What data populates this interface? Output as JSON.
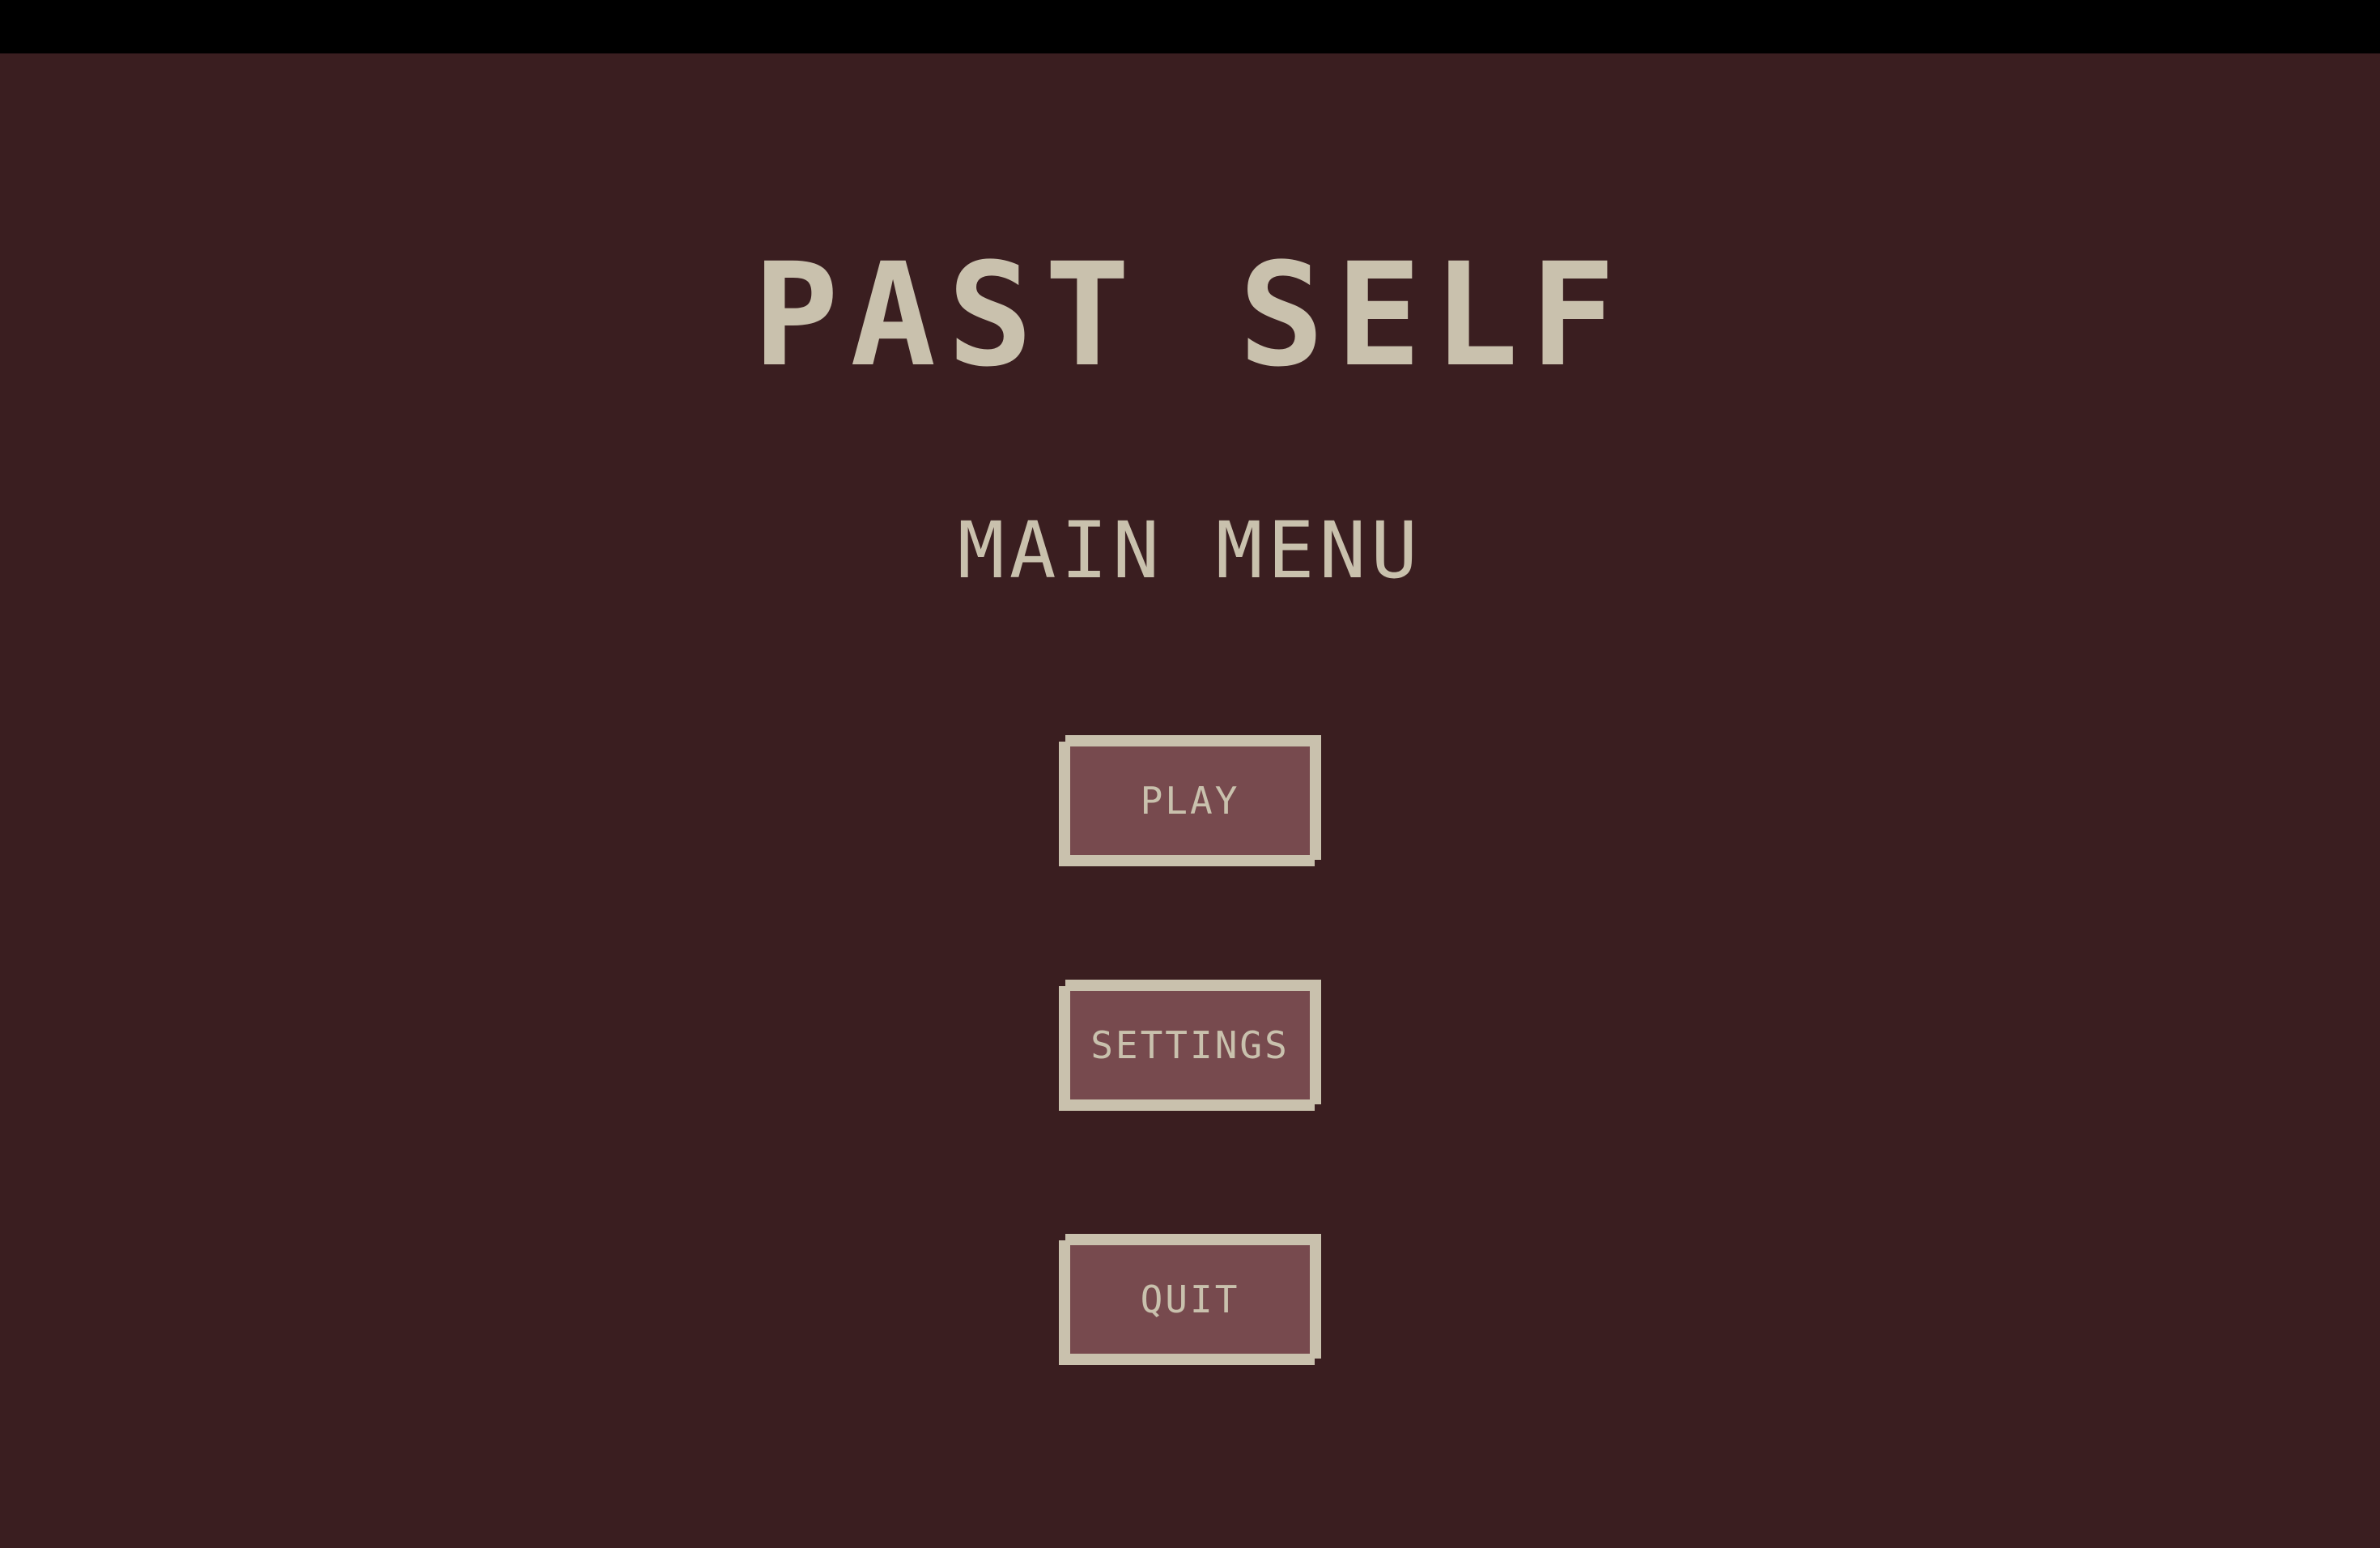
{
  "game": {
    "title": "PAST SELF",
    "subtitle": "MAIN MENU"
  },
  "menu": {
    "play_label": "PLAY",
    "settings_label": "SETTINGS",
    "quit_label": "QUIT"
  },
  "colors": {
    "background": "#3a1e20",
    "text": "#c9c1ad",
    "button_fill": "#774a4e",
    "button_border": "#c9c1ad",
    "top_bar": "#000000"
  }
}
